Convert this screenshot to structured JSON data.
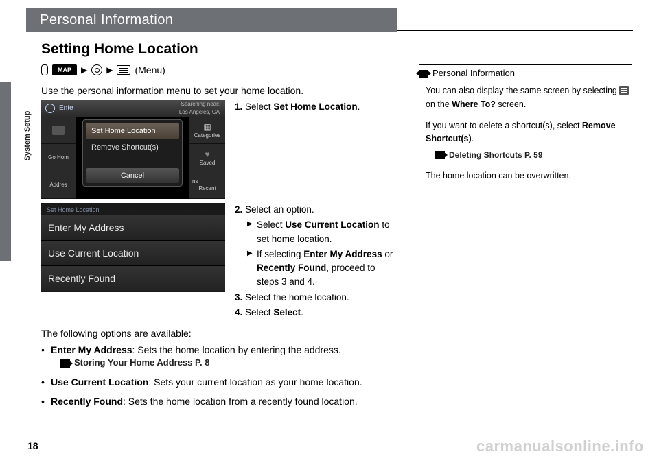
{
  "header": {
    "title": "Personal Information"
  },
  "sidetab": {
    "label": "System Setup"
  },
  "section": {
    "title": "Setting Home Location"
  },
  "breadcrumb": {
    "map": "MAP",
    "menu_label": "(Menu)"
  },
  "intro": "Use the personal information menu to set your home location.",
  "shot1": {
    "search_prefix": "Ente",
    "search_hint_l1": "Searching near:",
    "search_hint_l2": "Los Angeles, CA",
    "popup": {
      "item1": "Set Home Location",
      "item2": "Remove Shortcut(s)",
      "cancel": "Cancel"
    },
    "left": {
      "gohome": "Go Hom",
      "address": "Addres"
    },
    "right": {
      "categories": "Categories",
      "saved": "Saved",
      "recent": "Recent",
      "ns": "ns"
    }
  },
  "shot2": {
    "head": "Set Home Location",
    "i1": "Enter My Address",
    "i2": "Use Current Location",
    "i3": "Recently Found"
  },
  "steps": {
    "s1_n": "1.",
    "s1": "Select ",
    "s1_b": "Set Home Location",
    "s1_end": ".",
    "s2_n": "2.",
    "s2": "Select an option.",
    "s2a_pre": "Select ",
    "s2a_b": "Use Current Location",
    "s2a_post": " to set home location.",
    "s2b_pre": "If selecting ",
    "s2b_b1": "Enter My Address",
    "s2b_mid": " or ",
    "s2b_b2": "Recently Found",
    "s2b_post": ", proceed to steps 3 and 4.",
    "s3_n": "3.",
    "s3": "Select the home location.",
    "s4_n": "4.",
    "s4_pre": "Select ",
    "s4_b": "Select",
    "s4_end": "."
  },
  "options": {
    "intro": "The following options are available:",
    "o1_b": "Enter My Address",
    "o1": ": Sets the home location by entering the address.",
    "o1_xref": "Storing Your Home Address",
    "o1_xref_p": " P. 8",
    "o2_b": "Use Current Location",
    "o2": ": Sets your current location as your home location.",
    "o3_b": "Recently Found",
    "o3": ": Sets the home location from a recently found location."
  },
  "notes": {
    "head": "Personal Information",
    "p1a": "You can also display the same screen by selecting ",
    "p1b": " on the ",
    "p1c": "Where To?",
    "p1d": " screen.",
    "p2a": "If you want to delete a shortcut(s), select ",
    "p2b": "Remove Shortcut(s)",
    "p2c": ".",
    "xref": "Deleting Shortcuts",
    "xref_p": " P. 59",
    "p3": "The home location can be overwritten."
  },
  "pageno": "18",
  "watermark": "carmanualsonline.info"
}
